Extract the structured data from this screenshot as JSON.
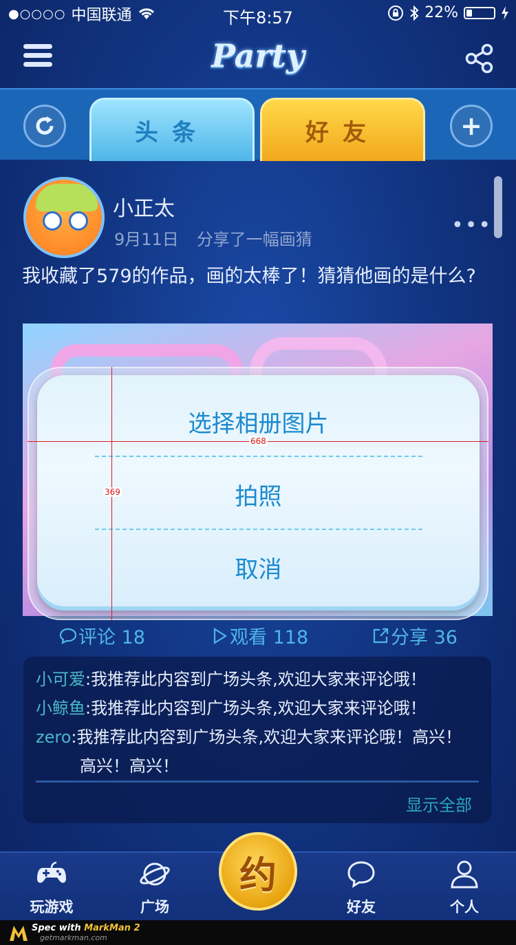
{
  "status_bar": {
    "signal": "●○○○○",
    "carrier": "中国联通",
    "time": "下午8:57",
    "battery_percent": "22%",
    "battery_level": 0.22
  },
  "nav": {
    "title": "Party"
  },
  "tabs": [
    {
      "label": "头条",
      "selected": false
    },
    {
      "label": "好友",
      "selected": true
    }
  ],
  "post": {
    "user_name": "小正太",
    "date": "9月11日",
    "action": "分享了一幅画猜",
    "text": "我收藏了579的作品，画的太棒了！猜猜他画的是什么?",
    "stats": {
      "comments": "评论 18",
      "views": "观看 118",
      "shares": "分享 36"
    },
    "comments": [
      {
        "author": "小可爱",
        "text": ":我推荐此内容到广场头条,欢迎大家来评论哦！"
      },
      {
        "author": "小鲸鱼",
        "text": ":我推荐此内容到广场头条,欢迎大家来评论哦！"
      },
      {
        "author": "zero",
        "text": ":我推荐此内容到广场头条,欢迎大家来评论哦！高兴！",
        "continuation": "高兴！高兴！"
      }
    ],
    "show_all": "显示全部"
  },
  "tab_bar": {
    "items": [
      {
        "label": "玩游戏",
        "icon": "gamepad-icon"
      },
      {
        "label": "广场",
        "icon": "planet-icon"
      },
      {
        "label": "好友",
        "icon": "chat-bubble-icon"
      },
      {
        "label": "个人",
        "icon": "person-icon"
      }
    ],
    "center_label": "约"
  },
  "dialog": {
    "options": [
      "选择相册图片",
      "拍照",
      "取消"
    ]
  },
  "spec": {
    "width_label": "668",
    "height_label": "369",
    "footer_title": "Spec with",
    "footer_brand": "MarkMan 2",
    "footer_url": "getmarkman.com"
  },
  "colors": {
    "background": "#123684",
    "accent_blue": "#1b8ad0",
    "tab_yellow": "#f2a81c",
    "tab_cyan": "#4fb6e8",
    "comment_author": "#49b8c8",
    "spec_red": "#e01a1a"
  }
}
